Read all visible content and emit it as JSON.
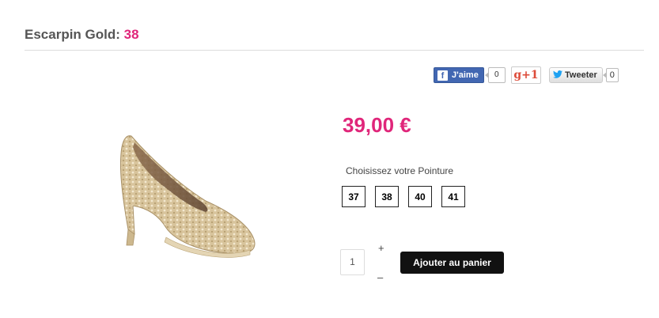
{
  "product": {
    "name_prefix": "Escarpin Gold: ",
    "name_size": "38",
    "price": "39,00 €"
  },
  "social": {
    "facebook": {
      "icon": "f",
      "label": "J'aime",
      "count": "0"
    },
    "google_plus": {
      "label": "g+1"
    },
    "twitter": {
      "label": "Tweeter",
      "count": "0"
    }
  },
  "size_selector": {
    "label": "Choisissez votre Pointure",
    "options": [
      "37",
      "38",
      "40",
      "41"
    ]
  },
  "quantity": {
    "value": "1",
    "plus_label": "+",
    "minus_label": "–"
  },
  "cart": {
    "add_label": "Ajouter au panier"
  },
  "colors": {
    "accent": "#e0267a",
    "button_dark": "#111111"
  }
}
